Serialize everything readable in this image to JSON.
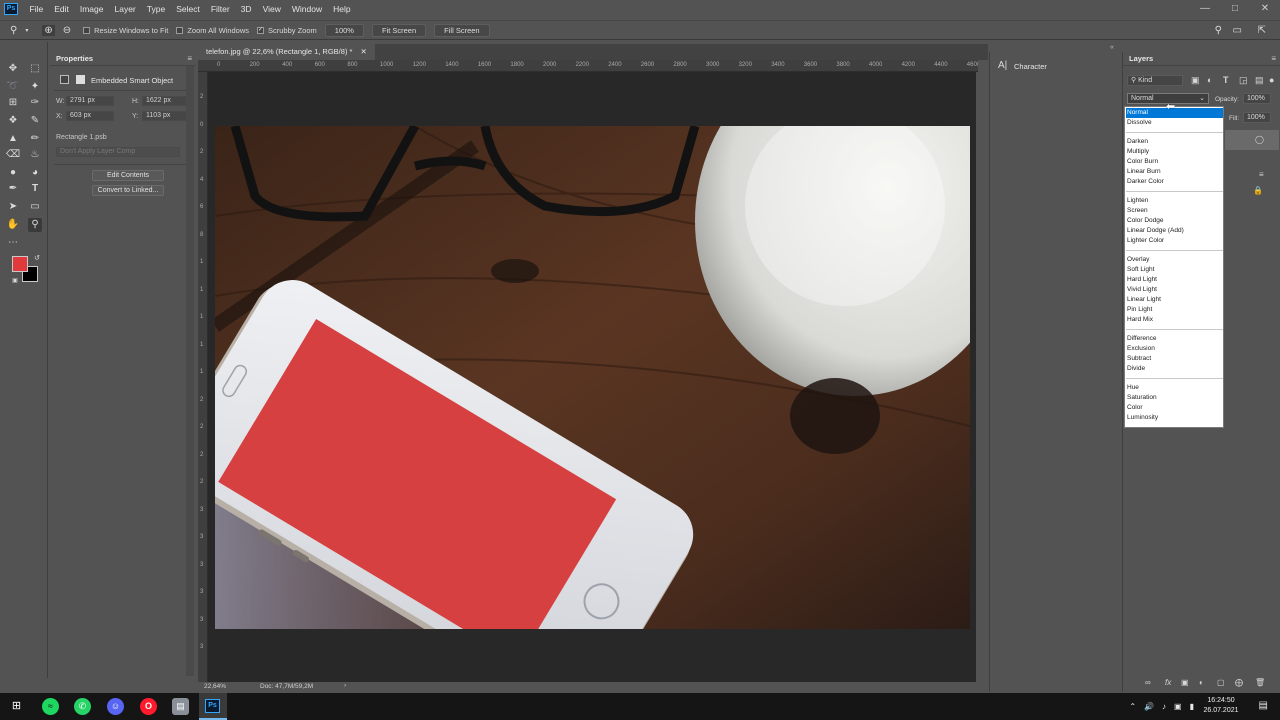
{
  "app": {
    "logo": "Ps"
  },
  "menu": [
    "File",
    "Edit",
    "Image",
    "Layer",
    "Type",
    "Select",
    "Filter",
    "3D",
    "View",
    "Window",
    "Help"
  ],
  "window_controls": [
    "minimize-icon",
    "maximize-icon",
    "close-icon"
  ],
  "options": {
    "resize_windows": "Resize Windows to Fit",
    "zoom_all_windows": "Zoom All Windows",
    "scrubby_zoom": "Scrubby Zoom",
    "zoom_value": "100%",
    "fit_screen": "Fit Screen",
    "fill_screen": "Fill Screen"
  },
  "properties": {
    "title": "Properties",
    "object_type": "Embedded Smart Object",
    "w_label": "W:",
    "w_value": "2791 px",
    "h_label": "H:",
    "h_value": "1622 px",
    "x_label": "X:",
    "x_value": "603 px",
    "y_label": "Y:",
    "y_value": "1103 px",
    "file": "Rectangle 1.psb",
    "layer_comp_placeholder": "Don't Apply Layer Comp",
    "edit_contents": "Edit Contents",
    "convert_linked": "Convert to Linked..."
  },
  "document": {
    "tab": "telefon.jpg @ 22,6% (Rectangle 1, RGB/8) *",
    "ruler_h": [
      "0",
      "200",
      "400",
      "600",
      "800",
      "1000",
      "1200",
      "1400",
      "1600",
      "1800",
      "2000",
      "2200",
      "2400",
      "2600",
      "2800",
      "3000",
      "3200",
      "3400",
      "3600",
      "3800",
      "4000",
      "4200",
      "4400",
      "4600",
      "4800",
      "5"
    ],
    "ruler_v": [
      "2",
      "0",
      "2",
      "4",
      "6",
      "8",
      "1",
      "1",
      "1",
      "1",
      "1",
      "2",
      "2",
      "2",
      "2",
      "3",
      "3",
      "3",
      "3",
      "3",
      "3"
    ],
    "zoom": "22,64%",
    "doc_size": "Doc: 47,7M/59,2M"
  },
  "character_panel": {
    "title": "Character"
  },
  "layers": {
    "title": "Layers",
    "filter": "Kind",
    "blend_mode": "Normal",
    "opacity_label": "Opacity:",
    "opacity_value": "100%",
    "fill_label": "Fill:",
    "fill_value": "100%"
  },
  "blend_modes": [
    [
      "Normal",
      "Dissolve"
    ],
    [
      "Darken",
      "Multiply",
      "Color Burn",
      "Linear Burn",
      "Darker Color"
    ],
    [
      "Lighten",
      "Screen",
      "Color Dodge",
      "Linear Dodge (Add)",
      "Lighter Color"
    ],
    [
      "Overlay",
      "Soft Light",
      "Hard Light",
      "Vivid Light",
      "Linear Light",
      "Pin Light",
      "Hard Mix"
    ],
    [
      "Difference",
      "Exclusion",
      "Subtract",
      "Divide"
    ],
    [
      "Hue",
      "Saturation",
      "Color",
      "Luminosity"
    ]
  ],
  "colors": {
    "foreground": "#e03a3a",
    "background": "#000000",
    "selection": "#0078d7",
    "phone_screen": "#d64040"
  },
  "taskbar": {
    "apps": [
      "windows-start-icon",
      "spotify-icon",
      "whatsapp-icon",
      "discord-icon",
      "opera-icon",
      "file-manager-icon",
      "photoshop-icon"
    ],
    "time": "16:24:50",
    "date": "26.07.2021"
  }
}
